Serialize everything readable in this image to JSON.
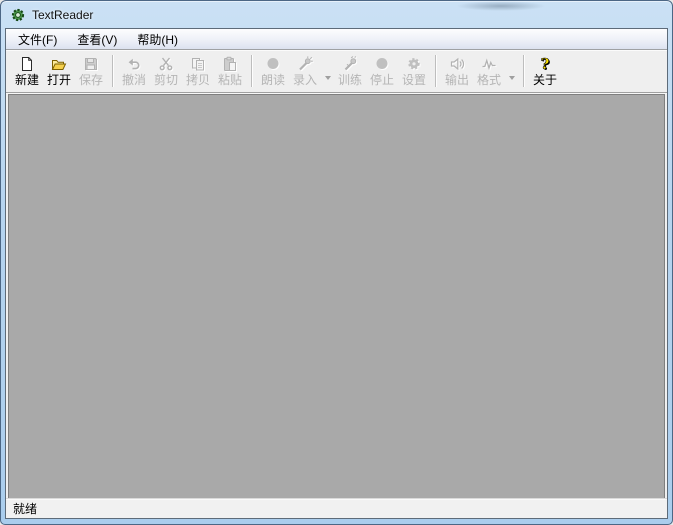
{
  "window": {
    "title": "TextReader",
    "app_icon": "app-gear-icon"
  },
  "menubar": {
    "items": [
      {
        "name": "file",
        "label": "文件(F)"
      },
      {
        "name": "view",
        "label": "查看(V)"
      },
      {
        "name": "help",
        "label": "帮助(H)"
      }
    ]
  },
  "toolbar": {
    "items": [
      {
        "type": "button",
        "name": "new",
        "label": "新建",
        "icon": "new-document-icon",
        "enabled": true
      },
      {
        "type": "button",
        "name": "open",
        "label": "打开",
        "icon": "open-folder-icon",
        "enabled": true
      },
      {
        "type": "button",
        "name": "save",
        "label": "保存",
        "icon": "save-floppy-icon",
        "enabled": false
      },
      {
        "type": "separator"
      },
      {
        "type": "button",
        "name": "undo",
        "label": "撤消",
        "icon": "undo-arrow-icon",
        "enabled": false
      },
      {
        "type": "button",
        "name": "cut",
        "label": "剪切",
        "icon": "cut-scissors-icon",
        "enabled": false
      },
      {
        "type": "button",
        "name": "copy",
        "label": "拷贝",
        "icon": "copy-pages-icon",
        "enabled": false
      },
      {
        "type": "button",
        "name": "paste",
        "label": "粘贴",
        "icon": "paste-clipboard-icon",
        "enabled": false
      },
      {
        "type": "separator"
      },
      {
        "type": "button",
        "name": "read-aloud",
        "label": "朗读",
        "icon": "read-circle-icon",
        "enabled": false
      },
      {
        "type": "button",
        "name": "record",
        "label": "录入",
        "icon": "record-mic-icon",
        "enabled": false
      },
      {
        "type": "dropdown",
        "name": "record-dropdown",
        "icon": "chevron-down-icon",
        "enabled": false
      },
      {
        "type": "button",
        "name": "train",
        "label": "训练",
        "icon": "train-mic-icon",
        "enabled": false
      },
      {
        "type": "button",
        "name": "stop",
        "label": "停止",
        "icon": "stop-circle-icon",
        "enabled": false
      },
      {
        "type": "button",
        "name": "settings",
        "label": "设置",
        "icon": "settings-gear-icon",
        "enabled": false
      },
      {
        "type": "separator"
      },
      {
        "type": "button",
        "name": "output",
        "label": "输出",
        "icon": "audio-output-speaker-icon",
        "enabled": false
      },
      {
        "type": "button",
        "name": "format",
        "label": "格式",
        "icon": "format-waveform-icon",
        "enabled": false
      },
      {
        "type": "dropdown",
        "name": "format-dropdown",
        "icon": "chevron-down-icon",
        "enabled": false
      },
      {
        "type": "separator"
      },
      {
        "type": "button",
        "name": "about",
        "label": "关于",
        "icon": "about-question-icon",
        "enabled": true
      }
    ]
  },
  "statusbar": {
    "text": "就绪"
  },
  "colors": {
    "titlebar_blue": "#b6d4ef",
    "frame_outline": "#4c6785",
    "menubar_tint": "#dce2f0",
    "toolbar_bg": "#efefef",
    "client_gray": "#a9a9a9",
    "status_bg": "#f1f1f1",
    "enabled_text": "#000000",
    "disabled_text": "#b5b5b5",
    "disabled_icon_gray": "#b2b2b2",
    "folder_yellow": "#f5d04c",
    "about_yellow": "#ffe500",
    "app_icon_green": "#4e9a4e"
  }
}
